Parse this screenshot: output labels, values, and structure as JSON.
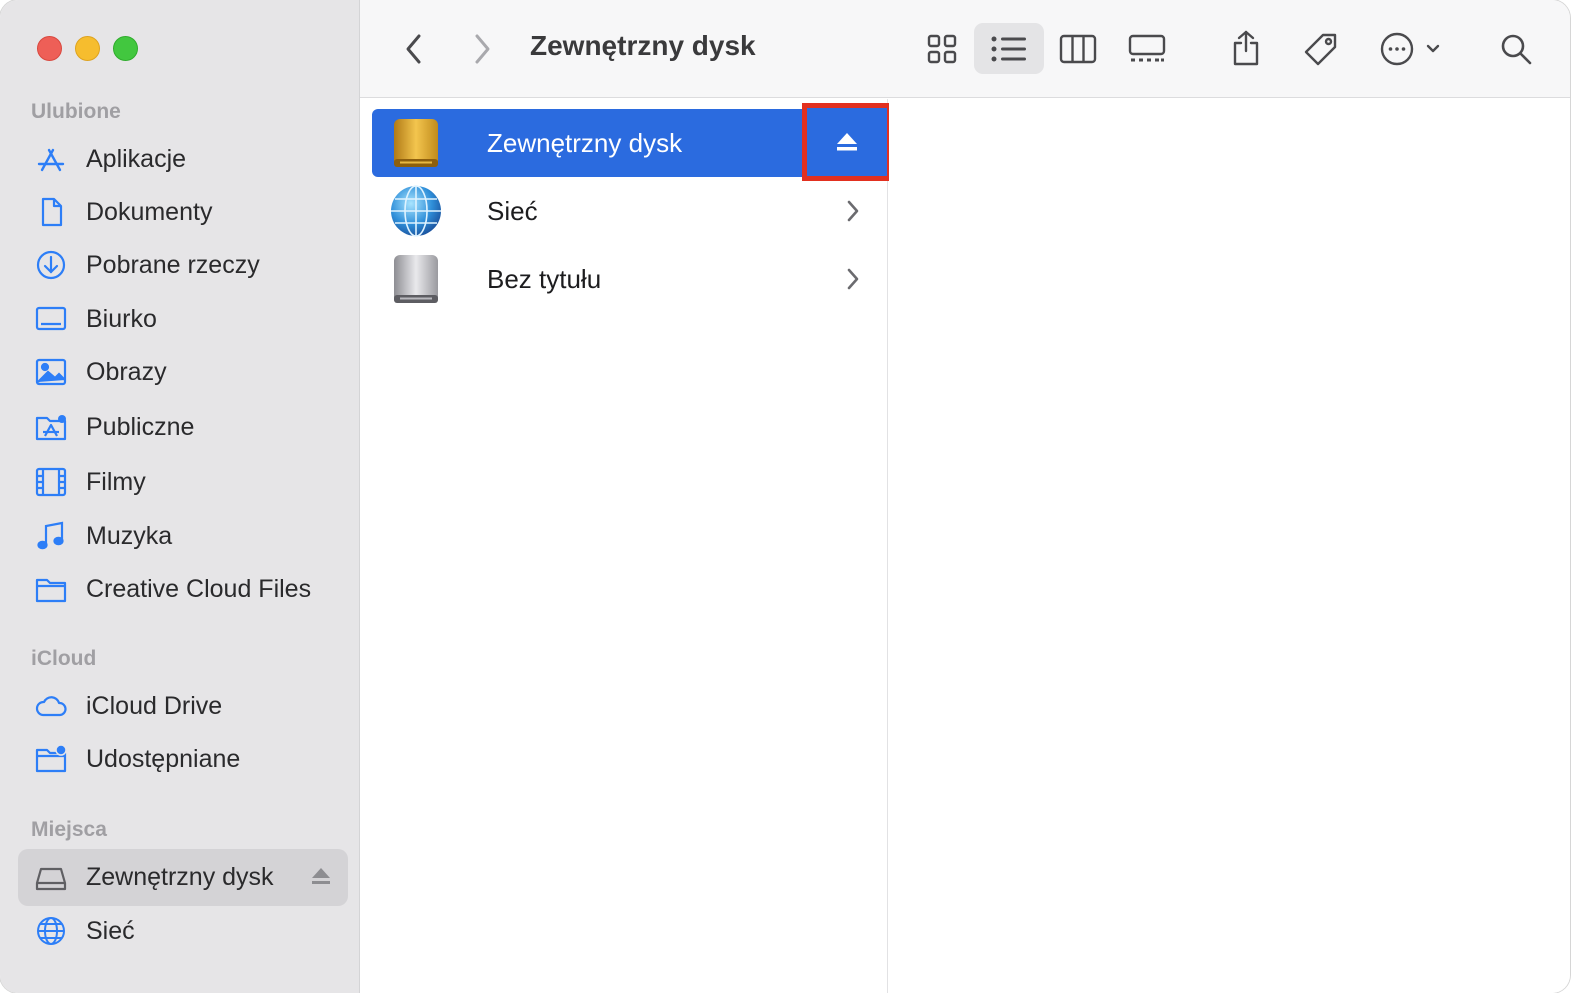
{
  "window": {
    "title": "Zewnętrzny dysk"
  },
  "sidebar": {
    "favorites": {
      "title": "Ulubione",
      "items": [
        {
          "label": "Aplikacje",
          "icon": "apps-icon"
        },
        {
          "label": "Dokumenty",
          "icon": "document-icon"
        },
        {
          "label": "Pobrane rzeczy",
          "icon": "download-icon"
        },
        {
          "label": "Biurko",
          "icon": "desktop-icon"
        },
        {
          "label": "Obrazy",
          "icon": "photos-icon"
        },
        {
          "label": "Publiczne",
          "icon": "public-folder-icon"
        },
        {
          "label": "Filmy",
          "icon": "film-icon"
        },
        {
          "label": "Muzyka",
          "icon": "music-icon"
        },
        {
          "label": "Creative Cloud Files",
          "icon": "folder-icon"
        }
      ]
    },
    "icloud": {
      "title": "iCloud",
      "items": [
        {
          "label": "iCloud Drive",
          "icon": "cloud-icon"
        },
        {
          "label": "Udostępniane",
          "icon": "shared-folder-icon"
        }
      ]
    },
    "locations": {
      "title": "Miejsca",
      "items": [
        {
          "label": "Zewnętrzny dysk",
          "icon": "external-drive-icon",
          "selected": true,
          "eject": true
        },
        {
          "label": "Sieć",
          "icon": "globe-icon"
        }
      ]
    }
  },
  "toolbar": {
    "title": "Zewnętrzny dysk",
    "active_view": "list",
    "buttons": [
      "back-icon",
      "forward-icon",
      "icon-view-icon",
      "list-view-icon",
      "column-view-icon",
      "gallery-view-icon",
      "share-icon",
      "tag-icon",
      "more-icon",
      "search-icon"
    ]
  },
  "column": {
    "items": [
      {
        "label": "Zewnętrzny dysk",
        "icon": "external-drive-icon",
        "selected": true,
        "eject": true
      },
      {
        "label": "Sieć",
        "icon": "network-icon",
        "chevron": true
      },
      {
        "label": "Bez tytułu",
        "icon": "disk-icon",
        "chevron": true
      }
    ]
  },
  "colors": {
    "selection": "#2b6bdf",
    "highlight_box": "#e2301f",
    "sidebar_bg": "#e6e5e7",
    "accent_icon": "#2d7ef7"
  }
}
